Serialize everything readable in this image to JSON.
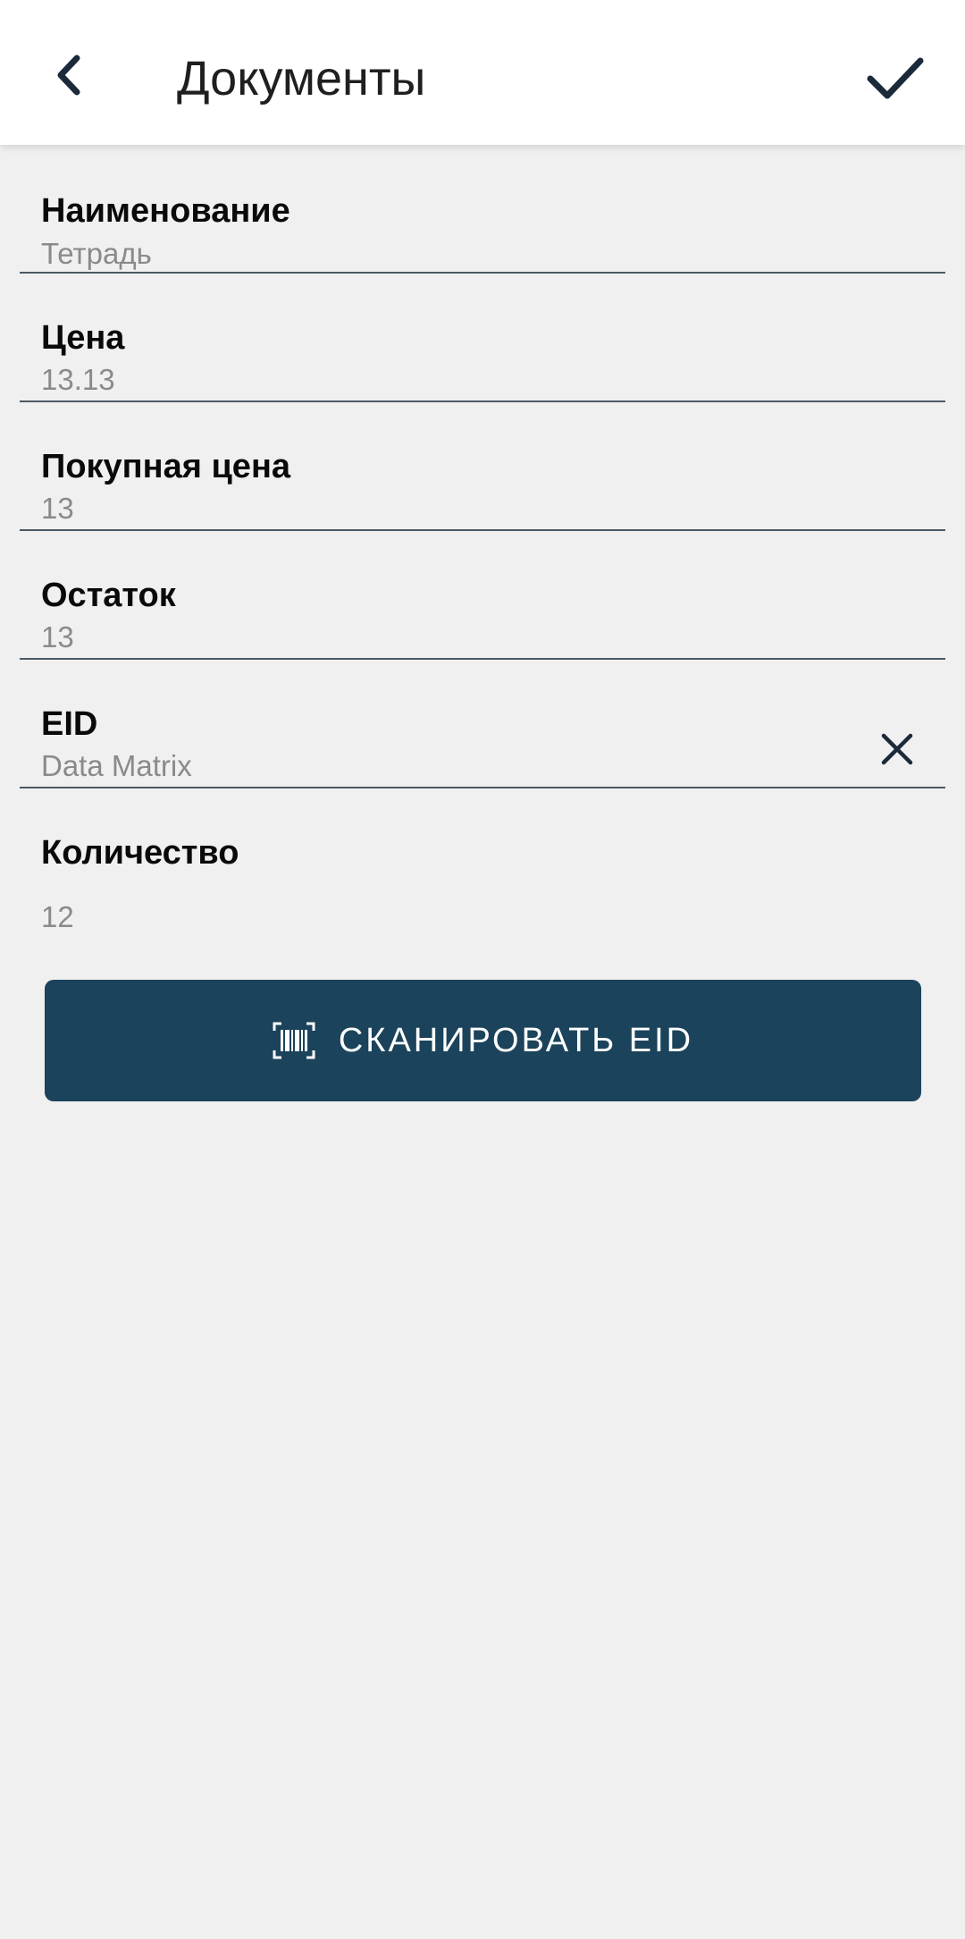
{
  "header": {
    "title": "Документы",
    "back_icon": "chevron-left-icon",
    "confirm_icon": "check-icon"
  },
  "fields": [
    {
      "label": "Наименование",
      "value": "Тетрадь"
    },
    {
      "label": "Цена",
      "value": "13.13"
    },
    {
      "label": "Покупная цена",
      "value": "13"
    },
    {
      "label": "Остаток",
      "value": "13"
    },
    {
      "label": "EID",
      "value": "Data Matrix",
      "clear_icon": "close-icon"
    },
    {
      "label": "Количество",
      "value": "12"
    }
  ],
  "scan_button": {
    "label": "СКАНИРОВАТЬ EID",
    "icon": "barcode-scan-icon"
  },
  "colors": {
    "accent": "#1b435b",
    "icon": "#1b2a3a",
    "background": "#f0f0f0",
    "divider": "#4b5a66",
    "value_text": "#8a8a8a"
  }
}
